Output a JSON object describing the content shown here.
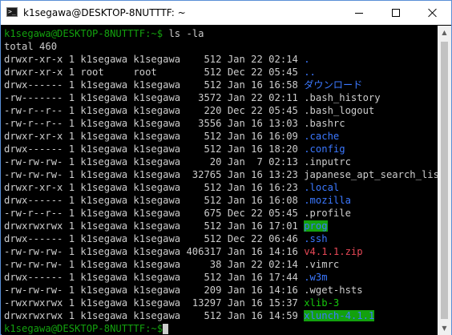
{
  "window": {
    "title": "k1segawa@DESKTOP-8NUTTTF: ~",
    "app_icon_glyph": ">_",
    "buttons": {
      "minimize": "minimize-icon",
      "maximize": "maximize-icon",
      "close": "close-icon"
    }
  },
  "terminal": {
    "prompt": "k1segawa@DESKTOP-8NUTTTF:~$",
    "command": " ls -la",
    "total": "total 460",
    "rows": [
      {
        "perm": "drwxr-xr-x",
        "links": "1",
        "owner": "k1segawa",
        "group": "k1segawa",
        "size": "512",
        "date": "Jan 22 02:14",
        "name": ".",
        "style": "blue"
      },
      {
        "perm": "drwxr-xr-x",
        "links": "1",
        "owner": "root",
        "group": "root",
        "size": "512",
        "date": "Dec 22 05:45",
        "name": "..",
        "style": "blue"
      },
      {
        "perm": "drwx------",
        "links": "1",
        "owner": "k1segawa",
        "group": "k1segawa",
        "size": "512",
        "date": "Jan 16 16:58",
        "name": "ダウンロード",
        "style": "blue"
      },
      {
        "perm": "-rw-------",
        "links": "1",
        "owner": "k1segawa",
        "group": "k1segawa",
        "size": "3572",
        "date": "Jan 22 02:11",
        "name": ".bash_history",
        "style": "plain"
      },
      {
        "perm": "-rw-r--r--",
        "links": "1",
        "owner": "k1segawa",
        "group": "k1segawa",
        "size": "220",
        "date": "Dec 22 05:45",
        "name": ".bash_logout",
        "style": "plain"
      },
      {
        "perm": "-rw-r--r--",
        "links": "1",
        "owner": "k1segawa",
        "group": "k1segawa",
        "size": "3556",
        "date": "Jan 16 13:03",
        "name": ".bashrc",
        "style": "plain"
      },
      {
        "perm": "drwxr-xr-x",
        "links": "1",
        "owner": "k1segawa",
        "group": "k1segawa",
        "size": "512",
        "date": "Jan 16 16:09",
        "name": ".cache",
        "style": "blue"
      },
      {
        "perm": "drwx------",
        "links": "1",
        "owner": "k1segawa",
        "group": "k1segawa",
        "size": "512",
        "date": "Jan 16 18:20",
        "name": ".config",
        "style": "blue"
      },
      {
        "perm": "-rw-rw-rw-",
        "links": "1",
        "owner": "k1segawa",
        "group": "k1segawa",
        "size": "20",
        "date": "Jan  7 02:13",
        "name": ".inputrc",
        "style": "plain"
      },
      {
        "perm": "-rw-rw-rw-",
        "links": "1",
        "owner": "k1segawa",
        "group": "k1segawa",
        "size": "32765",
        "date": "Jan 16 13:23",
        "name": "japanese_apt_search_list",
        "style": "plain"
      },
      {
        "perm": "drwxr-xr-x",
        "links": "1",
        "owner": "k1segawa",
        "group": "k1segawa",
        "size": "512",
        "date": "Jan 16 16:23",
        "name": ".local",
        "style": "blue"
      },
      {
        "perm": "drwx------",
        "links": "1",
        "owner": "k1segawa",
        "group": "k1segawa",
        "size": "512",
        "date": "Jan 16 16:08",
        "name": ".mozilla",
        "style": "blue"
      },
      {
        "perm": "-rw-r--r--",
        "links": "1",
        "owner": "k1segawa",
        "group": "k1segawa",
        "size": "675",
        "date": "Dec 22 05:45",
        "name": ".profile",
        "style": "plain"
      },
      {
        "perm": "drwxrwxrwx",
        "links": "1",
        "owner": "k1segawa",
        "group": "k1segawa",
        "size": "512",
        "date": "Jan 16 17:01",
        "name": "prog",
        "style": "hl"
      },
      {
        "perm": "drwx------",
        "links": "1",
        "owner": "k1segawa",
        "group": "k1segawa",
        "size": "512",
        "date": "Dec 22 06:46",
        "name": ".ssh",
        "style": "blue"
      },
      {
        "perm": "-rw-rw-rw-",
        "links": "1",
        "owner": "k1segawa",
        "group": "k1segawa",
        "size": "406317",
        "date": "Jan 16 14:16",
        "name": "v4.1.1.zip",
        "style": "red"
      },
      {
        "perm": "-rw-rw-rw-",
        "links": "1",
        "owner": "k1segawa",
        "group": "k1segawa",
        "size": "38",
        "date": "Jan 22 02:14",
        "name": ".vimrc",
        "style": "plain"
      },
      {
        "perm": "drwx------",
        "links": "1",
        "owner": "k1segawa",
        "group": "k1segawa",
        "size": "512",
        "date": "Jan 16 17:44",
        "name": ".w3m",
        "style": "blue"
      },
      {
        "perm": "-rw-rw-rw-",
        "links": "1",
        "owner": "k1segawa",
        "group": "k1segawa",
        "size": "209",
        "date": "Jan 16 14:16",
        "name": ".wget-hsts",
        "style": "plain"
      },
      {
        "perm": "-rwxrwxrwx",
        "links": "1",
        "owner": "k1segawa",
        "group": "k1segawa",
        "size": "13297",
        "date": "Jan 16 15:37",
        "name": "xlib-3",
        "style": "green"
      },
      {
        "perm": "drwxrwxrwx",
        "links": "1",
        "owner": "k1segawa",
        "group": "k1segawa",
        "size": "512",
        "date": "Jan 16 14:59",
        "name": "xlunch-4.1.1",
        "style": "hl"
      }
    ],
    "final_prompt": "k1segawa@DESKTOP-8NUTTTF:~$"
  },
  "colors": {
    "prompt": "#13a10e",
    "directory": "#3b78ff",
    "archive": "#e74856",
    "executable": "#16c60c",
    "highlight_bg": "#13a10e",
    "text": "#cccccc"
  }
}
